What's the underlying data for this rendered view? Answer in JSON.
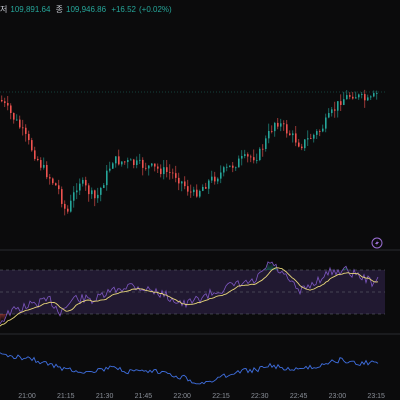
{
  "ohlc": {
    "low_label": "저",
    "low_value": "109,891.64",
    "close_label": "종",
    "close_value": "109,946.86",
    "change": "+16.52",
    "change_pct": "(+0.02%)"
  },
  "colors": {
    "up": "#26a69a",
    "down": "#ef5350",
    "rsi_line": "#7e57c2",
    "rsi_ma": "#e9d77a",
    "bottom_line": "#3f6fe0",
    "background": "#0b0b0c"
  },
  "x_axis": {
    "ticks": [
      "21:00",
      "21:15",
      "21:30",
      "21:45",
      "22:00",
      "22:15",
      "22:30",
      "22:45",
      "23:00",
      "23:15"
    ]
  },
  "icons": {
    "lightning": "lightning-icon"
  }
}
